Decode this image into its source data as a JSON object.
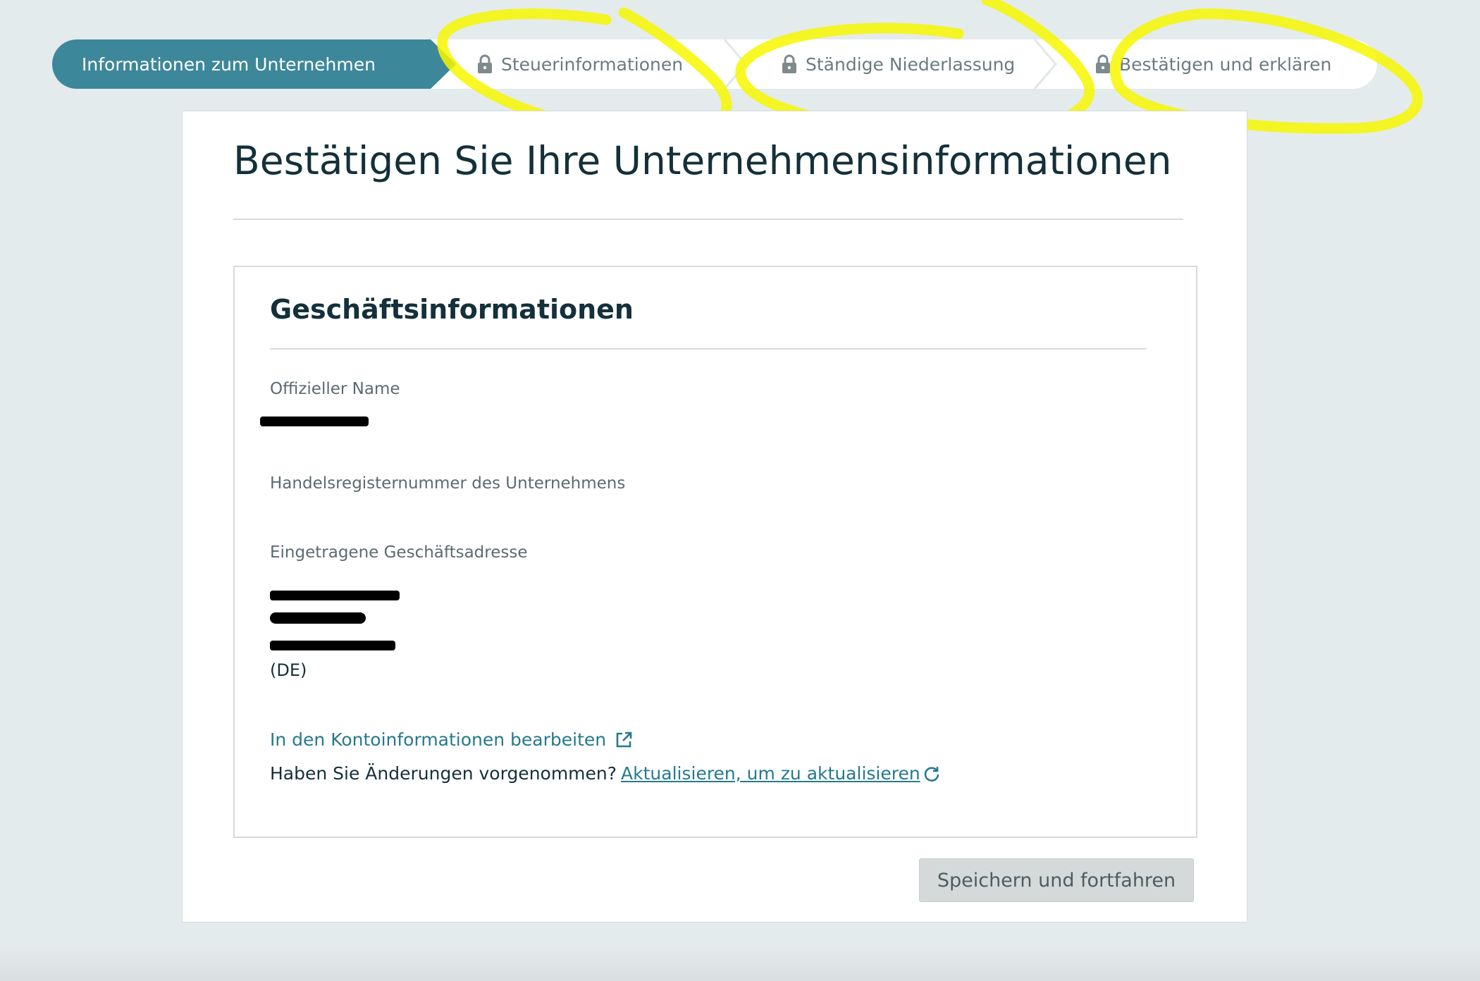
{
  "stepper": {
    "steps": [
      {
        "label": "Informationen zum Unternehmen",
        "state": "active"
      },
      {
        "label": "Steuerinformationen",
        "state": "locked"
      },
      {
        "label": "Ständige Niederlassung",
        "state": "locked"
      },
      {
        "label": "Bestätigen und erklären",
        "state": "locked"
      }
    ]
  },
  "page": {
    "title": "Bestätigen Sie Ihre Unternehmensinformationen"
  },
  "business_info": {
    "section_title": "Geschäftsinformationen",
    "official_name_label": "Offizieller Name",
    "official_name_value": "[redacted]",
    "trade_register_label": "Handelsregisternummer des Unternehmens",
    "address_label": "Eingetragene Geschäftsadresse",
    "address_country": "(DE)",
    "edit_link": "In den Kontoinformationen bearbeiten",
    "changes_question": "Haben Sie Änderungen vorgenommen?",
    "refresh_link": "Aktualisieren, um zu aktualisieren"
  },
  "actions": {
    "save_button": "Speichern und fortfahren"
  },
  "colors": {
    "active_step": "#3d879b",
    "link": "#25798f",
    "highlighter": "#f7f700",
    "background": "#e4ebed"
  },
  "icons": [
    "lock-icon",
    "external-link-icon",
    "refresh-icon"
  ]
}
